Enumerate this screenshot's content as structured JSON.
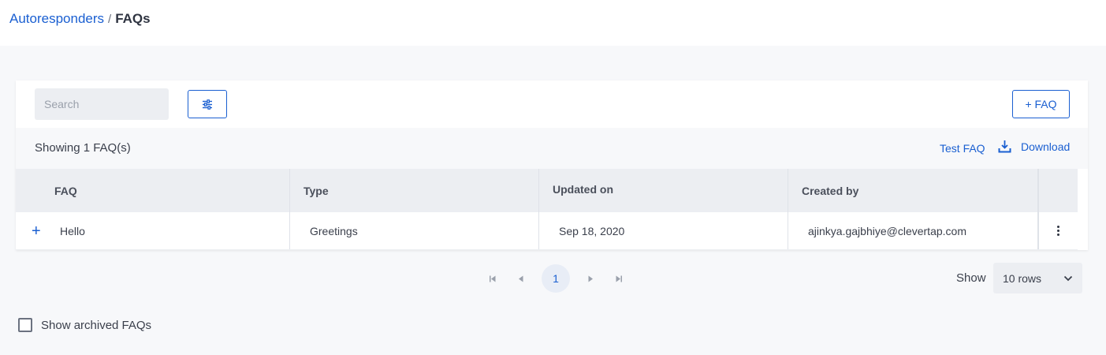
{
  "breadcrumb": {
    "parent": "Autoresponders",
    "separator": "/",
    "current": "FAQs"
  },
  "toolbar": {
    "search_placeholder": "Search",
    "filter_icon": "sliders-icon",
    "add_label": "+ FAQ"
  },
  "summary": {
    "showing": "Showing 1 FAQ(s)",
    "test_label": "Test FAQ",
    "download_label": "Download",
    "download_icon": "download-icon"
  },
  "table": {
    "columns": [
      "FAQ",
      "Type",
      "Updated on",
      "Created by"
    ],
    "rows": [
      {
        "faq": "Hello",
        "type": "Greetings",
        "updated_on": "Sep 18, 2020",
        "created_by": "ajinkya.gajbhiye@clevertap.com"
      }
    ]
  },
  "pagination": {
    "current_page": "1",
    "show_label": "Show",
    "rows_option": "10 rows"
  },
  "archived": {
    "label": "Show archived FAQs",
    "checked": false
  },
  "colors": {
    "accent": "#1a5fd1",
    "background": "#f7f8fa",
    "header_bg": "#eceef2"
  }
}
